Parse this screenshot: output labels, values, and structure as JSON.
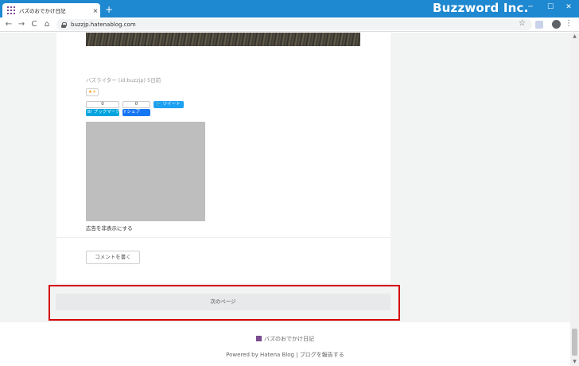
{
  "browser": {
    "tab_title": "バズのおでかけ日記",
    "tab_close": "×",
    "new_tab": "+",
    "url": "buzzjp.hatenablog.com",
    "brand_overlay": "Buzzword Inc.",
    "window_controls": {
      "minimize": "─",
      "maximize": "☐",
      "close": "✕"
    },
    "nav": {
      "back": "←",
      "forward": "→",
      "reload": "C",
      "home": "⌂"
    },
    "icons": {
      "star": "☆",
      "menu": "⋮"
    }
  },
  "article": {
    "byline": "バズライター (id:buzzjp) 5日前",
    "star_label": "★+",
    "hatena_bookmark": {
      "count": "0",
      "label": "B! ブックマーク",
      "color": "#00a4de"
    },
    "facebook_share": {
      "count": "0",
      "label": "f シェア",
      "color": "#1877f2"
    },
    "tweet_label": "ツイート",
    "ad_hide_link": "広告を非表示にする",
    "comment_button": "コメントを書く"
  },
  "pager": {
    "next_page": "次のページ"
  },
  "footer": {
    "blog_name": "バズのおでかけ日記",
    "powered_by": "Powered by Hatena Blog | ブログを報告する"
  },
  "colors": {
    "titlebar": "#1e88d0",
    "highlight": "#d40000"
  }
}
